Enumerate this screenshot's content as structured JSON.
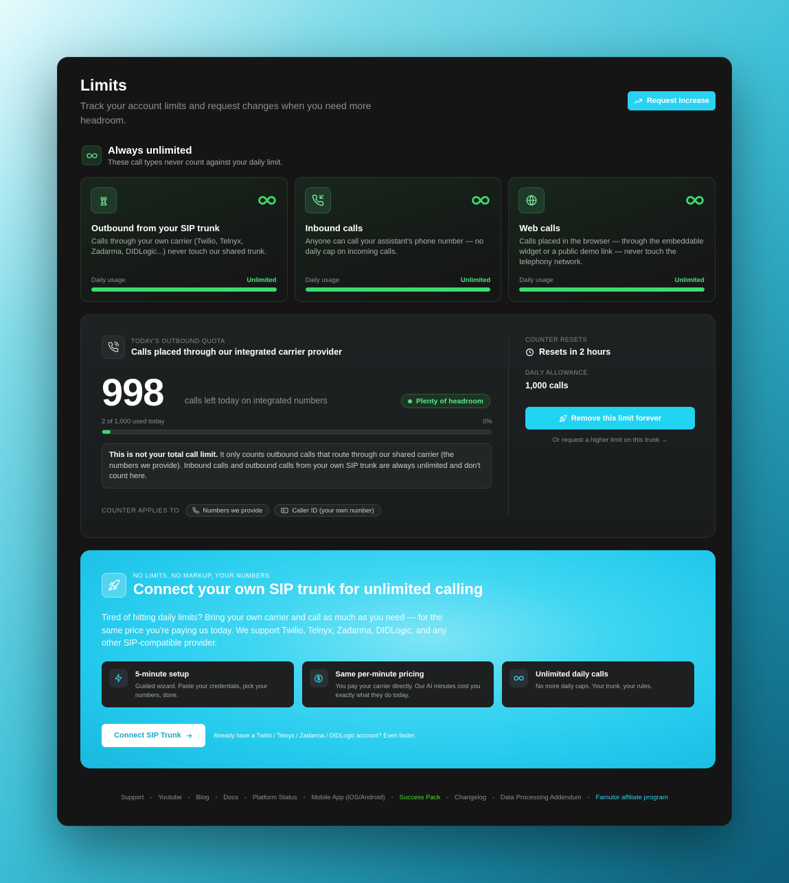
{
  "header": {
    "title": "Limits",
    "subtitle": "Track your account limits and request changes when you need more headroom.",
    "request_button": "Request Increase"
  },
  "unlimited": {
    "title": "Always unlimited",
    "subtitle": "These call types never count against your daily limit.",
    "cards": [
      {
        "icon": "broadcast-tower-icon",
        "title": "Outbound from your SIP trunk",
        "description": "Calls through your own carrier (Twilio, Telnyx, Zadarma, DIDLogic...) never touch our shared trunk.",
        "usage_label": "Daily usage",
        "usage_value": "Unlimited"
      },
      {
        "icon": "phone-incoming-icon",
        "title": "Inbound calls",
        "description": "Anyone can call your assistant's phone number — no daily cap on incoming calls.",
        "usage_label": "Daily usage",
        "usage_value": "Unlimited"
      },
      {
        "icon": "globe-icon",
        "title": "Web calls",
        "description": "Calls placed in the browser — through the embeddable widget or a public demo link — never touch the telephony network.",
        "usage_label": "Daily usage",
        "usage_value": "Unlimited"
      }
    ]
  },
  "quota": {
    "eyebrow": "TODAY'S OUTBOUND QUOTA",
    "title": "Calls placed through our integrated carrier provider",
    "remaining": "998",
    "remaining_caption": "calls left today on integrated numbers",
    "badge": "Plenty of headroom",
    "used_label": "2 of 1,000 used today",
    "percent_label": "0%",
    "used_fraction": 0.002,
    "note_bold": "This is not your total call limit.",
    "note_rest": " It only counts outbound calls that route through our shared carrier (the numbers we provide). Inbound calls and outbound calls from your own SIP trunk are always unlimited and don't count here.",
    "applies_label": "COUNTER APPLIES TO",
    "chips": [
      "Numbers we provide",
      "Caller ID (your own number)"
    ],
    "resets_label": "COUNTER RESETS",
    "resets_value": "Resets in 2 hours",
    "allowance_label": "DAILY ALLOWANCE",
    "allowance_value": "1,000 calls",
    "remove_button": "Remove this limit forever",
    "higher_link": "Or request a higher limit on this trunk →"
  },
  "promo": {
    "eyebrow": "NO LIMITS, NO MARKUP, YOUR NUMBERS",
    "title": "Connect your own SIP trunk for unlimited calling",
    "description": "Tired of hitting daily limits? Bring your own carrier and call as much as you need — for the same price you're paying us today. We support Twilio, Telnyx, Zadarma, DIDLogic, and any other SIP-compatible provider.",
    "features": [
      {
        "icon": "lightning-icon",
        "title": "5-minute setup",
        "description": "Guided wizard. Paste your credentials, pick your numbers, done."
      },
      {
        "icon": "dollar-coin-icon",
        "title": "Same per-minute pricing",
        "description": "You pay your carrier directly. Our AI minutes cost you exactly what they do today."
      },
      {
        "icon": "infinity-icon",
        "title": "Unlimited daily calls",
        "description": "No more daily caps. Your trunk, your rules."
      }
    ],
    "connect_button": "Connect SIP Trunk",
    "note": "Already have a Twilio / Telnyx / Zadarma / DIDLogic account? Even faster."
  },
  "footer": {
    "links": [
      "Support",
      "Youtube",
      "Blog",
      "Docs",
      "Platform Status",
      "Mobile App (iOS/Android)",
      "Success Pack",
      "Changelog",
      "Data Processing Addendum",
      "Famulor affiliate program"
    ]
  },
  "colors": {
    "accent_cyan": "#22d3f2",
    "success_green": "#3ddc6e",
    "success_pack_green": "#4ade2e",
    "affiliate_link_blue": "#2ad2f2"
  }
}
